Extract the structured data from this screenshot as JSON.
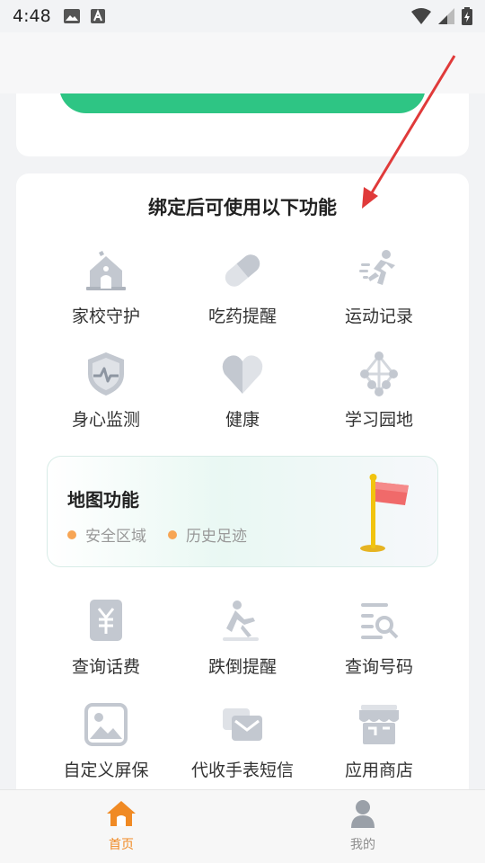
{
  "status_bar": {
    "time": "4:48"
  },
  "card": {
    "title": "绑定后可使用以下功能",
    "features_top": [
      {
        "label": "家校守护",
        "icon": "school-icon"
      },
      {
        "label": "吃药提醒",
        "icon": "pill-icon"
      },
      {
        "label": "运动记录",
        "icon": "running-icon"
      },
      {
        "label": "身心监测",
        "icon": "shield-heartbeat-icon"
      },
      {
        "label": "健康",
        "icon": "heart-icon"
      },
      {
        "label": "学习园地",
        "icon": "network-icon"
      }
    ],
    "map": {
      "title": "地图功能",
      "tags": [
        "安全区域",
        "历史足迹"
      ]
    },
    "features_bottom": [
      {
        "label": "查询话费",
        "icon": "bill-icon"
      },
      {
        "label": "跌倒提醒",
        "icon": "fall-icon"
      },
      {
        "label": "查询号码",
        "icon": "search-list-icon"
      },
      {
        "label": "自定义屏保",
        "icon": "image-icon"
      },
      {
        "label": "代收手表短信",
        "icon": "message-icon"
      },
      {
        "label": "应用商店",
        "icon": "store-icon"
      }
    ]
  },
  "tabbar": {
    "tabs": [
      {
        "label": "首页",
        "active": true
      },
      {
        "label": "我的",
        "active": false
      }
    ]
  },
  "colors": {
    "accent_green": "#2ec584",
    "tab_active": "#f08a24",
    "icon_gray": "#c3c8d0",
    "arrow_red": "#e03a3a"
  }
}
